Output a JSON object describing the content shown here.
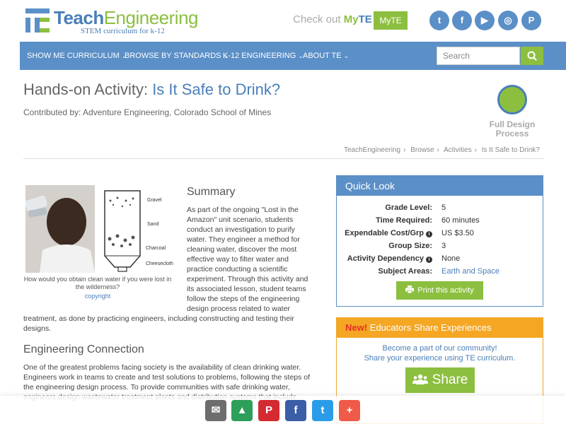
{
  "brand": {
    "name_part1": "Teach",
    "name_part2": "Engineering",
    "tagline": "STEM curriculum for k-12"
  },
  "myte": {
    "prefix": "Check out ",
    "my": "My",
    "te": "TE",
    "button": "MyTE"
  },
  "social": {
    "twitter": "t",
    "facebook": "f",
    "youtube": "▶",
    "instagram": "◎",
    "pinterest": "P"
  },
  "nav": {
    "items": [
      "SHOW ME CURRICULUM",
      "BROWSE BY STANDARDS",
      "K-12 ENGINEERING",
      "ABOUT TE"
    ],
    "chevron": "⌄",
    "search_placeholder": "Search"
  },
  "activity": {
    "type_prefix": "Hands-on Activity: ",
    "title": "Is It Safe to Drink?",
    "contributed": "Contributed by: Adventure Engineering, Colorado School of Mines",
    "design_label_line1": "Full Design",
    "design_label_line2": "Process"
  },
  "breadcrumb": {
    "items": [
      "TeachEngineering",
      "Browse",
      "Activities",
      "Is It Safe to Drink?"
    ],
    "sep": "›"
  },
  "figure": {
    "caption": "How would you obtain clean water if you were lost in the wilderness?",
    "copyright": "copyright",
    "labels": [
      "Gravel",
      "Sand",
      "Charcoal",
      "Cheesecloth"
    ]
  },
  "summary": {
    "heading": "Summary",
    "part1": "As part of the ongoing \"Lost in the Amazon\" unit scenario, students conduct an investigation to purify water. They engineer a method for cleaning water, discover the most effective way to filter water and practice conducting a scientific experiment. Through this activity and its associated lesson, student teams follow the steps of the engineering design process related to water",
    "part2": "treatment, as done by practicing engineers, including constructing and testing their designs."
  },
  "engineering": {
    "heading": "Engineering Connection",
    "text": "One of the greatest problems facing society is the availability of clean drinking water. Engineers work in teams to create and test solutions to problems, following the steps of the engineering design process. To provide communities with safe drinking water, engineers design wastewater treatment plants and distribution systems that include"
  },
  "quick_look": {
    "heading": "Quick Look",
    "rows": [
      {
        "label": "Grade Level:",
        "value": "5"
      },
      {
        "label": "Time Required:",
        "value": "60 minutes"
      },
      {
        "label": "Expendable Cost/Grp",
        "value": "US $3.50"
      },
      {
        "label": "Group Size:",
        "value": "3"
      },
      {
        "label": "Activity Dependency",
        "value": "None"
      },
      {
        "label": "Subject Areas:",
        "value": "Earth and Space"
      }
    ],
    "info_glyph": "i",
    "print_label": "Print this activity"
  },
  "share_box": {
    "new_label": "New!",
    "heading": " Educators Share Experiences",
    "line1": "Become a part of our community!",
    "line2": "Share your experience using TE curriculum.",
    "button": "Share"
  },
  "share_bar": {
    "email": "✉",
    "classroom": "▲",
    "pinterest": "P",
    "facebook": "f",
    "twitter": "t",
    "more": "+"
  }
}
